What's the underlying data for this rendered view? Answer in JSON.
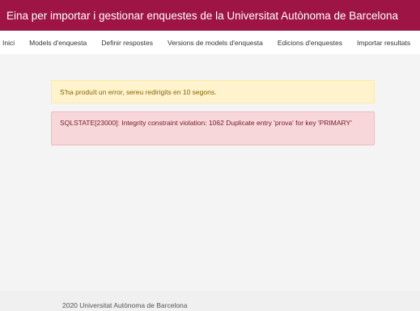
{
  "header": {
    "title": "Eina per importar i gestionar enquestes de la Universitat Autònoma de Barcelona"
  },
  "nav": {
    "items": [
      "Inici",
      "Models d'enquesta",
      "Definir respostes",
      "Versions de models d'enquesta",
      "Edicions d'enquestes",
      "Importar resultats"
    ]
  },
  "alerts": {
    "warning": "S'ha produït un error, sereu redirigits en 10 segons.",
    "error": "SQLSTATE[23000]: Integrity constraint violation: 1062 Duplicate entry 'prova' for key 'PRIMARY'"
  },
  "footer": {
    "text": "2020 Universitat Autònoma de Barcelona"
  },
  "colors": {
    "brand": "#9e1444",
    "warning_bg": "#fff3cd",
    "error_bg": "#f8d7da"
  }
}
